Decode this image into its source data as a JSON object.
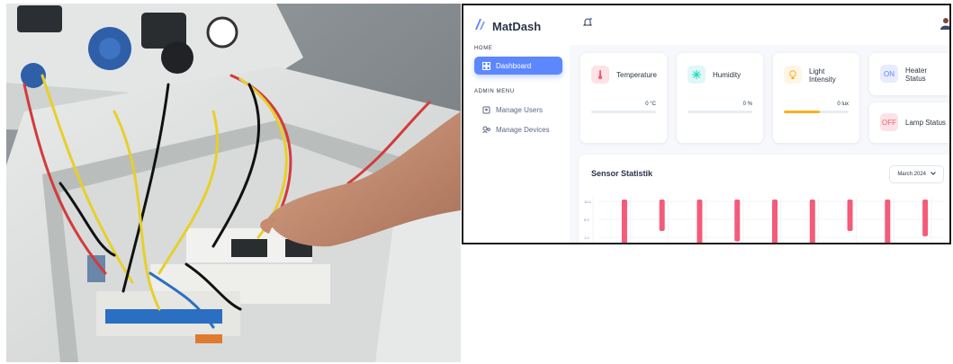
{
  "app": {
    "brand": "MatDash",
    "colors": {
      "primary": "#5d87ff",
      "text": "#2a3547",
      "chart_bar": "#f45b7a"
    }
  },
  "photo": {
    "description_icon": "control-panel-wiring-photo"
  },
  "sidebar": {
    "section_home": "HOME",
    "section_admin": "ADMIN MENU",
    "items": [
      {
        "label": "Dashboard",
        "icon": "dashboard-icon",
        "active": true
      },
      {
        "label": "Manage Users",
        "icon": "users-icon",
        "active": false
      },
      {
        "label": "Manage Devices",
        "icon": "devices-icon",
        "active": false
      }
    ]
  },
  "topbar": {
    "icons": [
      "bell-icon",
      "avatar"
    ]
  },
  "cards": {
    "temperature": {
      "title": "Temperature",
      "value": "0 °C",
      "progress": 0,
      "icon": "thermometer-icon"
    },
    "humidity": {
      "title": "Humidity",
      "value": "0 %",
      "progress": 0,
      "icon": "snowflake-icon"
    },
    "light": {
      "title_line1": "Light",
      "title_line2": "Intensity",
      "value": "0 lux",
      "progress": 0.55,
      "icon": "bulb-icon"
    },
    "heater": {
      "title_line1": "Heater",
      "title_line2": "Status",
      "badge": "ON"
    },
    "lamp": {
      "title": "Lamp Status",
      "badge": "OFF"
    }
  },
  "chart": {
    "title": "Sensor Statistik",
    "month": "March 2024",
    "y_ticks": [
      "10.0",
      "5.0",
      "1.0"
    ]
  },
  "chart_data": {
    "type": "bar",
    "title": "Sensor Statistik",
    "series": [
      {
        "values": [
          10.0,
          6.0,
          10.0,
          8.0,
          10.0,
          10.0,
          6.0,
          10.0,
          7.0
        ]
      }
    ],
    "ylim": [
      0,
      12
    ],
    "grid": true
  }
}
